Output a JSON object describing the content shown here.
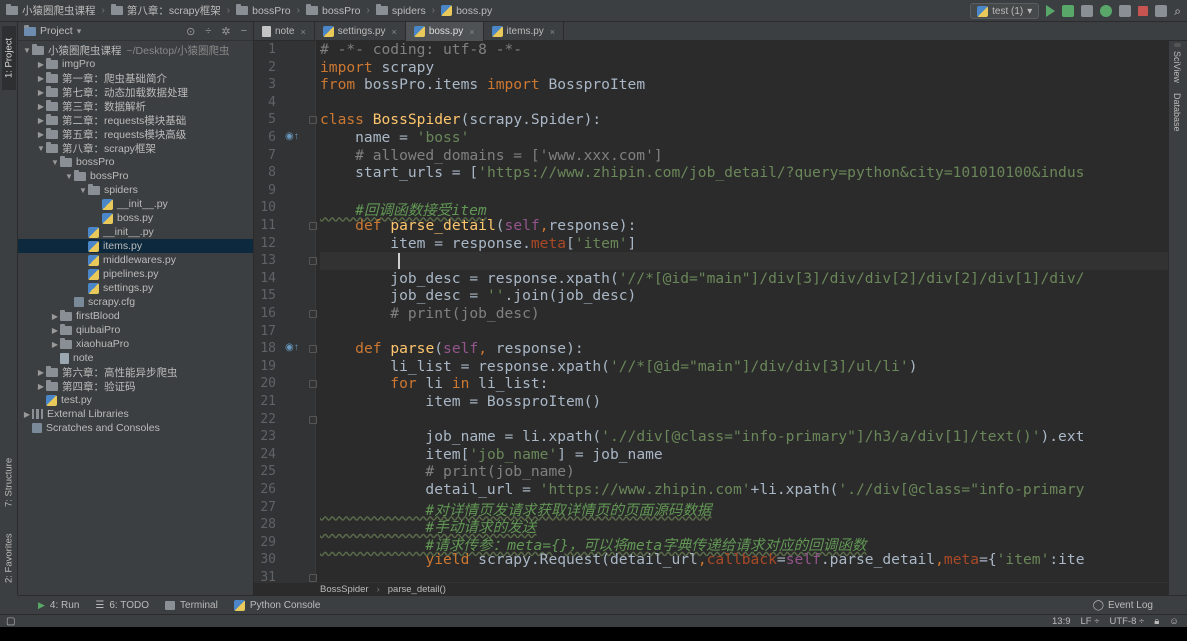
{
  "breadcrumb": [
    "小猿圈爬虫课程",
    "第八章：scrapy框架",
    "bossPro",
    "bossPro",
    "spiders",
    "boss.py"
  ],
  "run_config": "test (1)",
  "tool_windows": {
    "project": "1: Project",
    "structure": "7: Structure",
    "favorites": "2: Favorites",
    "sciview": "SciView",
    "database": "Database"
  },
  "project_panel": {
    "title": "Project",
    "tree": [
      {
        "label": "小猿圈爬虫课程",
        "extra": "~/Desktop/小猿圈爬虫",
        "depth": 0,
        "kind": "folder",
        "expanded": true
      },
      {
        "label": "imgPro",
        "depth": 1,
        "kind": "folder",
        "expanded": false
      },
      {
        "label": "第一章：爬虫基础简介",
        "depth": 1,
        "kind": "folder",
        "expanded": false
      },
      {
        "label": "第七章：动态加载数据处理",
        "depth": 1,
        "kind": "folder",
        "expanded": false
      },
      {
        "label": "第三章：数据解析",
        "depth": 1,
        "kind": "folder",
        "expanded": false
      },
      {
        "label": "第二章：requests模块基础",
        "depth": 1,
        "kind": "folder",
        "expanded": false
      },
      {
        "label": "第五章：requests模块高级",
        "depth": 1,
        "kind": "folder",
        "expanded": false
      },
      {
        "label": "第八章：scrapy框架",
        "depth": 1,
        "kind": "folder",
        "expanded": true
      },
      {
        "label": "bossPro",
        "depth": 2,
        "kind": "folder",
        "expanded": true
      },
      {
        "label": "bossPro",
        "depth": 3,
        "kind": "folder",
        "expanded": true
      },
      {
        "label": "spiders",
        "depth": 4,
        "kind": "folder",
        "expanded": true
      },
      {
        "label": "__init__.py",
        "depth": 5,
        "kind": "py"
      },
      {
        "label": "boss.py",
        "depth": 5,
        "kind": "py"
      },
      {
        "label": "__init__.py",
        "depth": 4,
        "kind": "py"
      },
      {
        "label": "items.py",
        "depth": 4,
        "kind": "py",
        "selected": true
      },
      {
        "label": "middlewares.py",
        "depth": 4,
        "kind": "py"
      },
      {
        "label": "pipelines.py",
        "depth": 4,
        "kind": "py"
      },
      {
        "label": "settings.py",
        "depth": 4,
        "kind": "py"
      },
      {
        "label": "scrapy.cfg",
        "depth": 3,
        "kind": "cfg"
      },
      {
        "label": "firstBlood",
        "depth": 2,
        "kind": "folder",
        "expanded": false
      },
      {
        "label": "qiubaiPro",
        "depth": 2,
        "kind": "folder",
        "expanded": false
      },
      {
        "label": "xiaohuaPro",
        "depth": 2,
        "kind": "folder",
        "expanded": false
      },
      {
        "label": "note",
        "depth": 2,
        "kind": "file"
      },
      {
        "label": "第六章：高性能异步爬虫",
        "depth": 1,
        "kind": "folder",
        "expanded": false
      },
      {
        "label": "第四章：验证码",
        "depth": 1,
        "kind": "folder",
        "expanded": false
      },
      {
        "label": "test.py",
        "depth": 1,
        "kind": "py"
      },
      {
        "label": "External Libraries",
        "depth": 0,
        "kind": "lib",
        "expanded": false
      },
      {
        "label": "Scratches and Consoles",
        "depth": 0,
        "kind": "scratch"
      }
    ]
  },
  "editor_tabs": [
    {
      "label": "note",
      "kind": "note",
      "active": false
    },
    {
      "label": "settings.py",
      "kind": "py",
      "active": false
    },
    {
      "label": "boss.py",
      "kind": "py",
      "active": true
    },
    {
      "label": "items.py",
      "kind": "py",
      "active": false
    }
  ],
  "code_lines": [
    "# -*- coding: utf-8 -*-",
    "import scrapy",
    "from bossPro.items import BossproItem",
    "",
    "class BossSpider(scrapy.Spider):",
    "    name = 'boss'",
    "    # allowed_domains = ['www.xxx.com']",
    "    start_urls = ['https://www.zhipin.com/job_detail/?query=python&city=101010100&indus",
    "",
    "    #回调函数接受item",
    "    def parse_detail(self,response):",
    "        item = response.meta['item']",
    "",
    "        job_desc = response.xpath('//*[@id=\"main\"]/div[3]/div/div[2]/div[2]/div[1]/div/",
    "        job_desc = ''.join(job_desc)",
    "        # print(job_desc)",
    "",
    "    def parse(self, response):",
    "        li_list = response.xpath('//*[@id=\"main\"]/div/div[3]/ul/li')",
    "        for li in li_list:",
    "            item = BossproItem()",
    "",
    "            job_name = li.xpath('.//div[@class=\"info-primary\"]/h3/a/div[1]/text()').ext",
    "            item['job_name'] = job_name",
    "            # print(job_name)",
    "            detail_url = 'https://www.zhipin.com'+li.xpath('.//div[@class=\"info-primary",
    "            #对详情页发请求获取详情页的页面源码数据",
    "            #手动请求的发送",
    "            #请求传参：meta={}，可以将meta字典传递给请求对应的回调函数",
    "            yield scrapy.Request(detail_url,callback=self.parse_detail,meta={'item':ite",
    ""
  ],
  "editor_breadcrumb": [
    "BossSpider",
    "parse_detail()"
  ],
  "bottom_tabs": [
    "4: Run",
    "6: TODO",
    "Terminal",
    "Python Console"
  ],
  "event_log": "Event Log",
  "status": {
    "position": "13:9",
    "line_sep": "LF",
    "encoding": "UTF-8"
  }
}
